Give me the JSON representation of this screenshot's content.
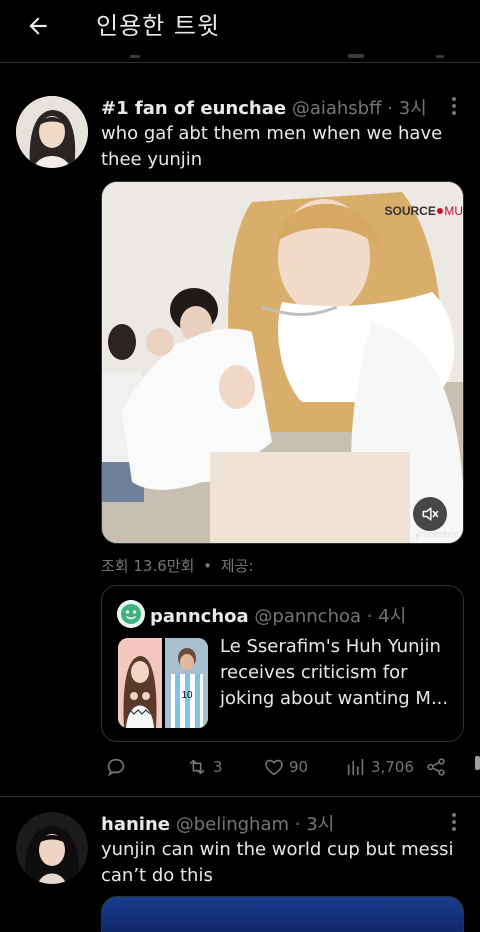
{
  "header": {
    "title": "인용한 트윗"
  },
  "tweets": [
    {
      "name": "#1 fan of eunchae",
      "handle": "@aiahsbff",
      "time": "3시",
      "text_lines": [
        "who gaf abt them men when we have",
        "thee yunjin"
      ],
      "media": {
        "logo_text": "SOURCE",
        "logo_text_tail": "MU",
        "watermark": "ynjcentric"
      },
      "views": "조회 13.6만회",
      "views_sep": "•",
      "views_from": "제공:",
      "quote": {
        "name": "pannchoa",
        "handle": "@pannchoa",
        "time": "4시",
        "text": "Le Sserafim's Huh Yunjin receives criticism for joking about wanting M..."
      },
      "actions": {
        "retweets": "3",
        "likes": "90",
        "views": "3,706"
      }
    },
    {
      "name": "hanine",
      "handle": "@belingham",
      "time": "3시",
      "text_lines": [
        "yunjin can win the world cup but messi",
        "can’t do this"
      ]
    }
  ],
  "colors": {
    "background": "#000000",
    "text": "#e7e9ea",
    "muted": "#71767b",
    "border": "#2f3336"
  },
  "icons": [
    "back-arrow-icon",
    "more-icon",
    "mute-icon",
    "reply-icon",
    "retweet-icon",
    "like-icon",
    "views-icon",
    "share-icon"
  ]
}
